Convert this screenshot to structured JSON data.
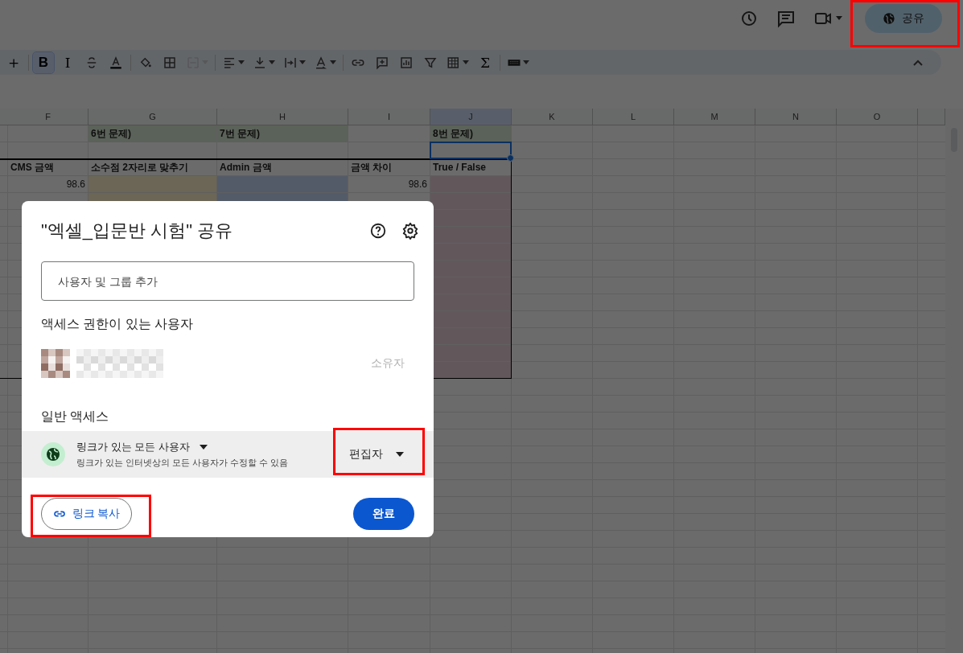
{
  "topbar": {
    "icons": [
      {
        "kind": "history"
      },
      {
        "kind": "comment"
      },
      {
        "kind": "video"
      }
    ],
    "share_button": {
      "label": "공유",
      "highlighted": true
    }
  },
  "toolbar": {
    "groups": [
      [
        {
          "kind": "text",
          "label": "+",
          "selected": false,
          "disabled": false,
          "caret": false
        }
      ],
      [
        {
          "kind": "text",
          "label": "B",
          "selected": true,
          "disabled": false,
          "caret": false
        },
        {
          "kind": "text",
          "label": "I",
          "selected": false,
          "disabled": false,
          "caret": false
        },
        {
          "kind": "strike",
          "selected": false,
          "disabled": false,
          "caret": false
        },
        {
          "kind": "textcolor",
          "selected": false,
          "disabled": false,
          "caret": false
        }
      ],
      [
        {
          "kind": "fill",
          "selected": false,
          "disabled": false,
          "caret": false
        },
        {
          "kind": "borders",
          "selected": false,
          "disabled": false,
          "caret": false
        },
        {
          "kind": "merge",
          "selected": false,
          "disabled": true,
          "caret": true
        }
      ],
      [
        {
          "kind": "align",
          "selected": false,
          "disabled": false,
          "caret": true
        },
        {
          "kind": "valign",
          "selected": false,
          "disabled": false,
          "caret": true
        },
        {
          "kind": "wrap",
          "selected": false,
          "disabled": false,
          "caret": true
        },
        {
          "kind": "rotate",
          "selected": false,
          "disabled": false,
          "caret": true
        }
      ],
      [
        {
          "kind": "link",
          "selected": false,
          "disabled": false,
          "caret": false
        },
        {
          "kind": "addcomment",
          "selected": false,
          "disabled": false,
          "caret": false
        },
        {
          "kind": "chart",
          "selected": false,
          "disabled": false,
          "caret": false
        },
        {
          "kind": "filter",
          "selected": false,
          "disabled": false,
          "caret": false
        },
        {
          "kind": "table",
          "selected": false,
          "disabled": false,
          "caret": true
        },
        {
          "kind": "text",
          "label": "Σ",
          "selected": false,
          "disabled": false,
          "caret": false
        }
      ],
      [
        {
          "kind": "keyboard",
          "selected": false,
          "disabled": false,
          "caret": true
        }
      ]
    ]
  },
  "sheet": {
    "columns": [
      {
        "label": "F",
        "selected": false
      },
      {
        "label": "G",
        "selected": false
      },
      {
        "label": "H",
        "selected": false
      },
      {
        "label": "I",
        "selected": false
      },
      {
        "label": "J",
        "selected": true
      },
      {
        "label": "K",
        "selected": false
      },
      {
        "label": "L",
        "selected": false
      },
      {
        "label": "M",
        "selected": false
      },
      {
        "label": "N",
        "selected": false
      },
      {
        "label": "O",
        "selected": false
      }
    ],
    "rows": [
      {
        "kind": "title",
        "active": false,
        "cells": [
          "",
          "6번 문제)",
          "7번 문제)",
          "",
          "8번 문제)"
        ]
      },
      {
        "kind": "blank",
        "active": true
      },
      {
        "kind": "header",
        "active": false,
        "cells": [
          "CMS 금액",
          "소수점 2자리로 맞추기",
          "Admin 금액",
          "금액 차이",
          "True / False"
        ]
      },
      {
        "kind": "data",
        "active": false,
        "cells": [
          "98.6",
          "",
          "",
          "98.6"
        ]
      },
      {
        "kind": "data",
        "active": false
      },
      {
        "kind": "data",
        "active": false
      },
      {
        "kind": "data",
        "active": false
      },
      {
        "kind": "data",
        "active": false
      },
      {
        "kind": "data",
        "active": false
      },
      {
        "kind": "data",
        "active": false
      },
      {
        "kind": "data",
        "active": false
      },
      {
        "kind": "data",
        "active": false
      },
      {
        "kind": "data",
        "active": false
      },
      {
        "kind": "data",
        "active": false
      },
      {
        "kind": "data",
        "active": false
      }
    ]
  },
  "dialog": {
    "title": "\"엑셀_입문반 시험\" 공유",
    "search": {
      "placeholder": "사용자 및 그룹 추가"
    },
    "people_heading": "액세스 권한이 있는 사용자",
    "people": [
      {
        "role": "소유자"
      }
    ],
    "general_heading": "일반 액세스",
    "general": {
      "scope": "링크가 있는 모든 사용자",
      "description": "링크가 있는 인터넷상의 모든 사용자가 수정할 수 있음",
      "role": "편집자",
      "highlighted": true
    },
    "copy_link": {
      "label": "링크 복사",
      "highlighted": true
    },
    "done": "완료"
  }
}
